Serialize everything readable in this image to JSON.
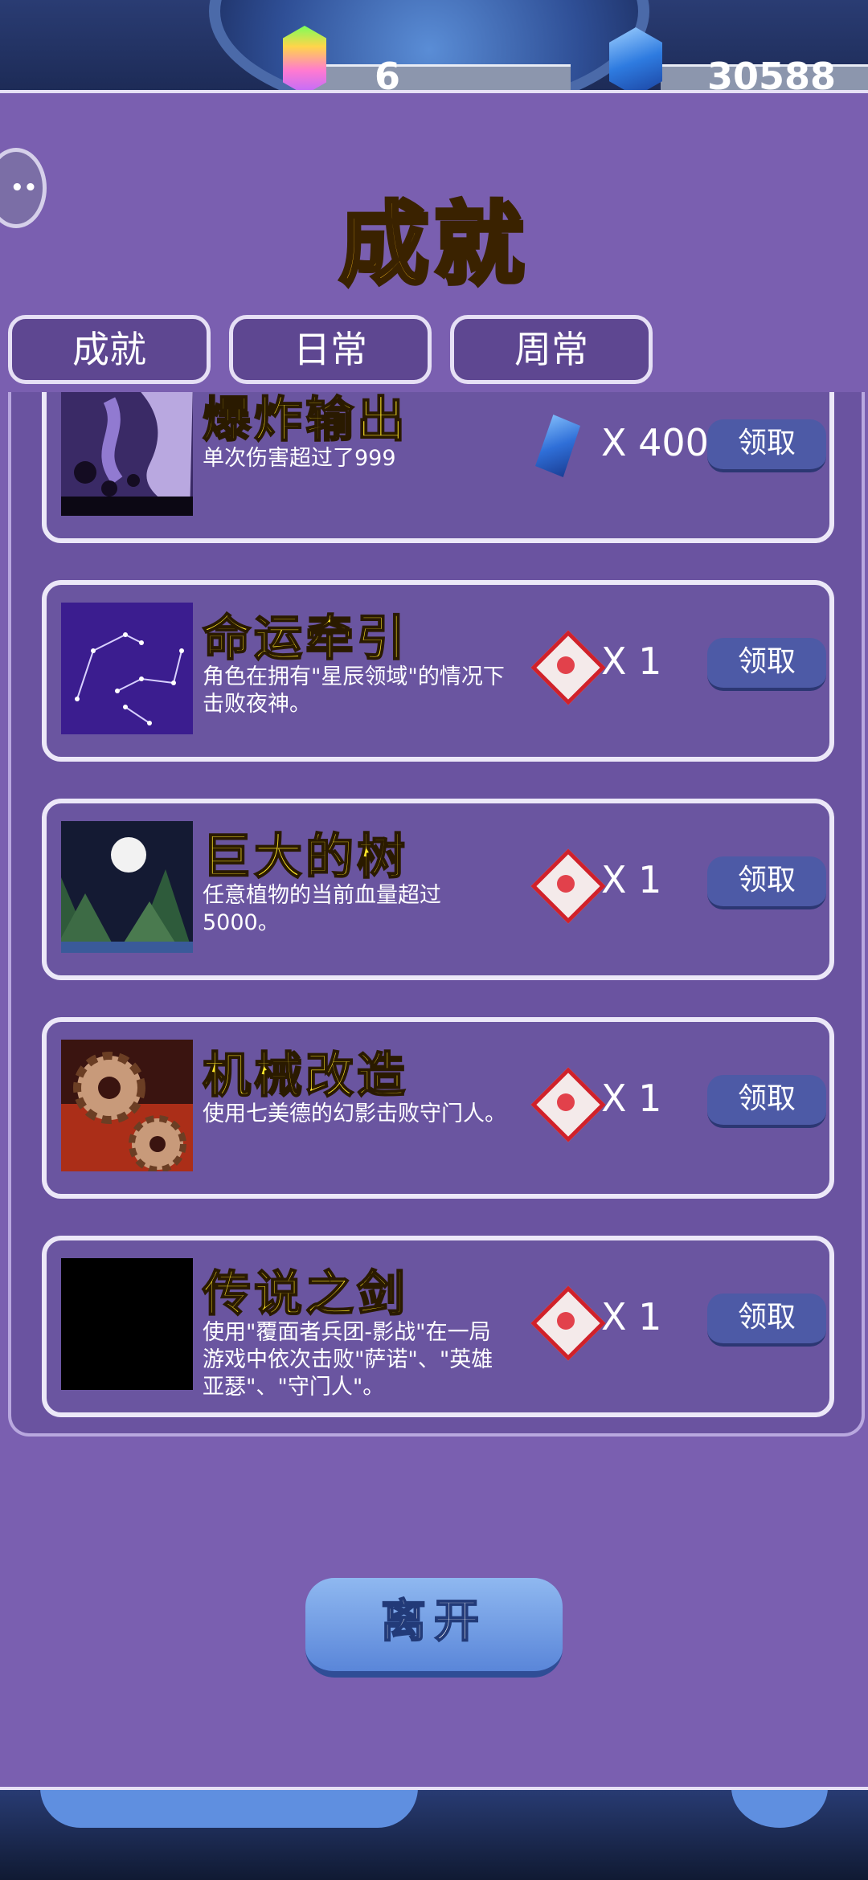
{
  "hud": {
    "rainbow_count": "6",
    "gem_count": "30588"
  },
  "header": {
    "title": "成就"
  },
  "tabs": [
    {
      "label": "成就"
    },
    {
      "label": "日常"
    },
    {
      "label": "周常"
    }
  ],
  "achievements": [
    {
      "name": "爆炸输出",
      "desc": "单次伤害超过了999",
      "reward_icon": "blue-gem-icon",
      "reward_qty": "X 400",
      "claim_label": "领取"
    },
    {
      "name": "命运牵引",
      "desc": "角色在拥有\"星辰领域\"的情况下击败夜神。",
      "reward_icon": "ticket-icon",
      "reward_qty": "X   1",
      "claim_label": "领取"
    },
    {
      "name": "巨大的树",
      "desc": "任意植物的当前血量超过5000。",
      "reward_icon": "ticket-icon",
      "reward_qty": "X   1",
      "claim_label": "领取"
    },
    {
      "name": "机械改造",
      "desc": "使用七美德的幻影击败守门人。",
      "reward_icon": "ticket-icon",
      "reward_qty": "X   1",
      "claim_label": "领取"
    },
    {
      "name": "传说之剑",
      "desc": "使用\"覆面者兵团-影战\"在一局游戏中依次击败\"萨诺\"、\"英雄亚瑟\"、\"守门人\"。",
      "reward_icon": "ticket-icon",
      "reward_qty": "X   1",
      "claim_label": "领取"
    }
  ],
  "footer": {
    "leave_label": "离开"
  }
}
